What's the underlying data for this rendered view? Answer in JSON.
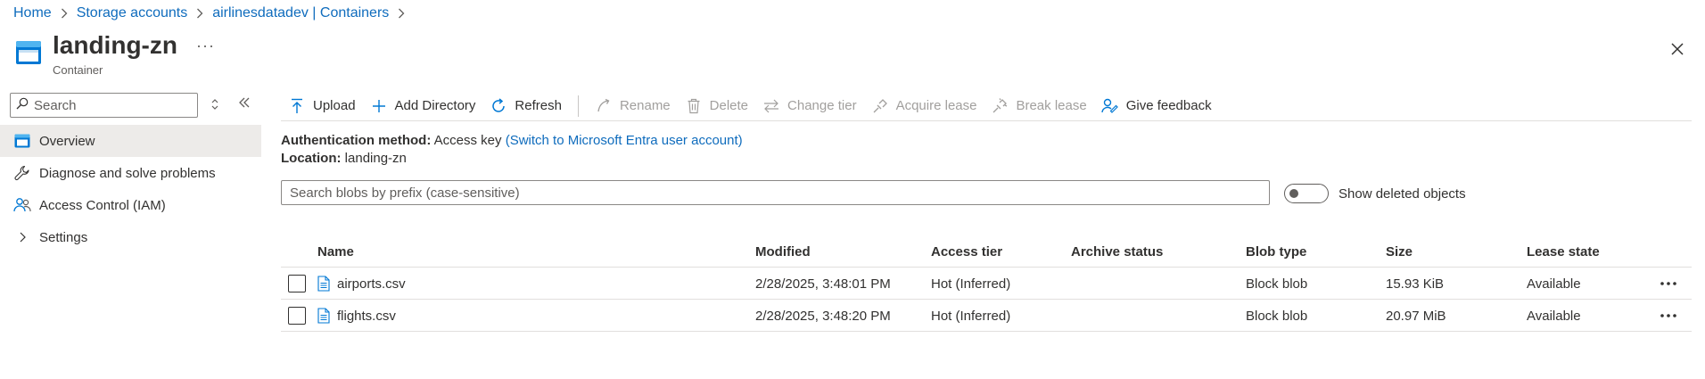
{
  "breadcrumb": {
    "items": [
      "Home",
      "Storage accounts",
      "airlinesdatadev | Containers"
    ]
  },
  "header": {
    "title": "landing-zn",
    "subtitle": "Container",
    "more": "···"
  },
  "sidebar": {
    "search_placeholder": "Search",
    "items": [
      {
        "label": "Overview",
        "icon": "container-overview-icon",
        "active": true
      },
      {
        "label": "Diagnose and solve problems",
        "icon": "wrench-icon",
        "active": false
      },
      {
        "label": "Access Control (IAM)",
        "icon": "people-icon",
        "active": false
      },
      {
        "label": "Settings",
        "icon": "chevron-right-icon",
        "active": false
      }
    ]
  },
  "toolbar": {
    "upload": "Upload",
    "add_directory": "Add Directory",
    "refresh": "Refresh",
    "rename": "Rename",
    "delete": "Delete",
    "change_tier": "Change tier",
    "acquire_lease": "Acquire lease",
    "break_lease": "Break lease",
    "give_feedback": "Give feedback"
  },
  "info": {
    "auth_label": "Authentication method:",
    "auth_value": "Access key",
    "auth_link": "(Switch to Microsoft Entra user account)",
    "location_label": "Location:",
    "location_value": "landing-zn"
  },
  "filter": {
    "placeholder": "Search blobs by prefix (case-sensitive)",
    "show_deleted_label": "Show deleted objects",
    "show_deleted_on": false
  },
  "table": {
    "columns": {
      "name": "Name",
      "modified": "Modified",
      "access_tier": "Access tier",
      "archive_status": "Archive status",
      "blob_type": "Blob type",
      "size": "Size",
      "lease_state": "Lease state"
    },
    "rows": [
      {
        "name": "airports.csv",
        "modified": "2/28/2025, 3:48:01 PM",
        "access_tier": "Hot (Inferred)",
        "archive_status": "",
        "blob_type": "Block blob",
        "size": "15.93 KiB",
        "lease_state": "Available",
        "more": "···"
      },
      {
        "name": "flights.csv",
        "modified": "2/28/2025, 3:48:20 PM",
        "access_tier": "Hot (Inferred)",
        "archive_status": "",
        "blob_type": "Block blob",
        "size": "20.97 MiB",
        "lease_state": "Available",
        "more": "···"
      }
    ]
  },
  "colors": {
    "link": "#0f6cbd",
    "azure_blue": "#0078d4",
    "disabled": "#a19f9d",
    "active_nav": "#edebe9"
  }
}
